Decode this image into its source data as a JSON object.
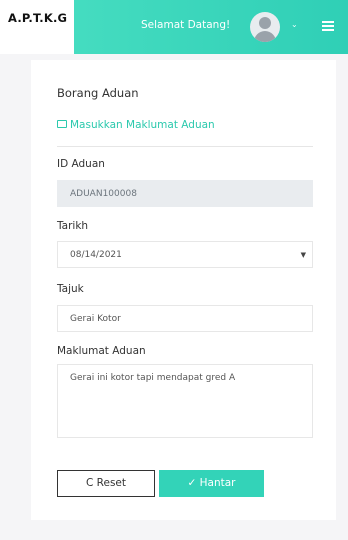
{
  "header": {
    "brand": "A.P.T.K.G",
    "welcome": "Selamat Datang!",
    "caret": "⌄"
  },
  "form": {
    "title": "Borang Aduan",
    "subtitle": "Masukkan Maklumat Aduan",
    "fields": {
      "id_label": "ID Aduan",
      "id_value": "ADUAN100008",
      "date_label": "Tarikh",
      "date_value": "08/14/2021",
      "subject_label": "Tajuk",
      "subject_value": "Gerai Kotor",
      "details_label": "Maklumat Aduan",
      "details_value": "Gerai ini kotor tapi mendapat gred A"
    },
    "buttons": {
      "reset": "C  Reset",
      "submit": "✓  Hantar"
    }
  },
  "colors": {
    "accent": "#33d3b8",
    "header_gradient_start": "#45dcc0",
    "header_gradient_end": "#2fcfb6"
  }
}
